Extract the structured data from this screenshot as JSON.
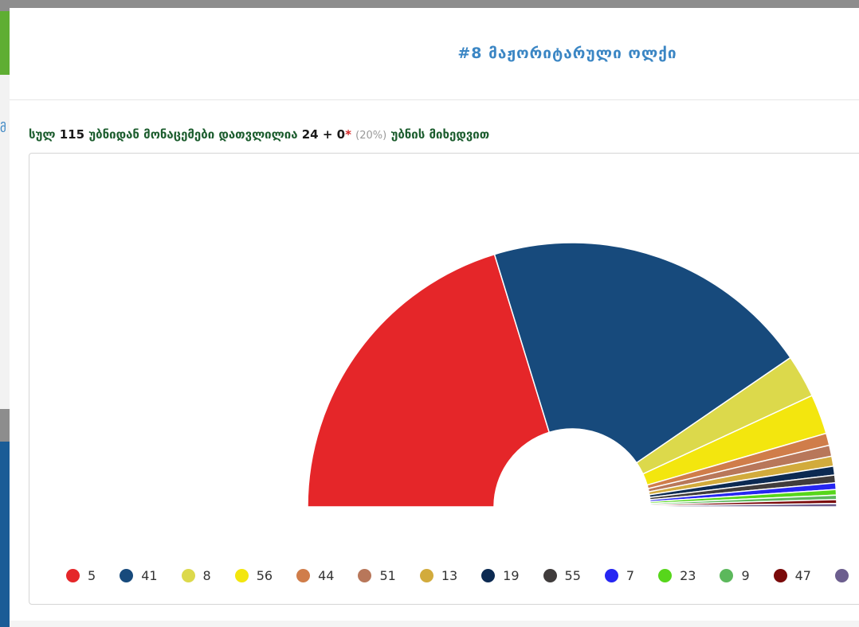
{
  "header": {
    "title": "#8 მაჟორიტარული ოლქი"
  },
  "sidebar_peek": {
    "letter": "მ"
  },
  "summary": {
    "prefix": "სულ",
    "total": "115",
    "middle": "უბნიდან მონაცემები დათვლილია",
    "counted": "24 + 0",
    "star": "*",
    "percent": "(20%)",
    "suffix": "უბნის მიხედვით"
  },
  "chart_data": {
    "type": "pie",
    "variant": "half-donut",
    "title": "",
    "series": [
      {
        "name": "5",
        "value": 30.0,
        "color": "#e52629"
      },
      {
        "name": "41",
        "value": 29.9,
        "color": "#174a7c"
      },
      {
        "name": "8",
        "value": 3.9,
        "color": "#dcd94b"
      },
      {
        "name": "56",
        "value": 3.6,
        "color": "#f3e60e"
      },
      {
        "name": "44",
        "value": 1.1,
        "color": "#d07d4a"
      },
      {
        "name": "51",
        "value": 1.0,
        "color": "#b8775a"
      },
      {
        "name": "13",
        "value": 0.9,
        "color": "#d2ab3c"
      },
      {
        "name": "19",
        "value": 0.8,
        "color": "#0c2a52"
      },
      {
        "name": "55",
        "value": 0.7,
        "color": "#403c3c"
      },
      {
        "name": "7",
        "value": 0.6,
        "color": "#2626f2"
      },
      {
        "name": "23",
        "value": 0.5,
        "color": "#57d61b"
      },
      {
        "name": "9",
        "value": 0.4,
        "color": "#5cb85c"
      },
      {
        "name": "47",
        "value": 0.35,
        "color": "#7a0a0a"
      },
      {
        "name": "",
        "value": 0.3,
        "color": "#6c5e8e"
      }
    ],
    "legend_position": "bottom"
  }
}
